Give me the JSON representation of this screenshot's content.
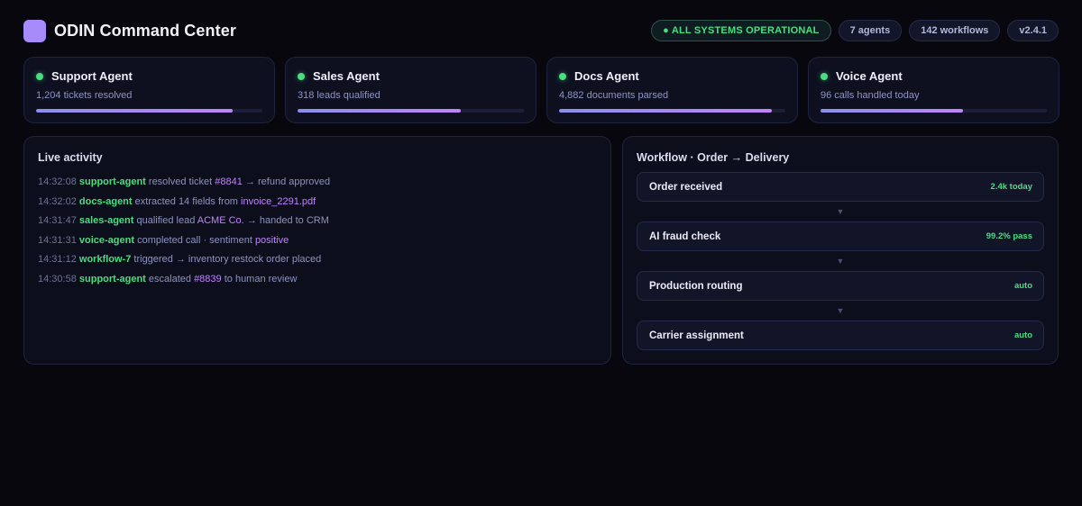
{
  "header": {
    "title": "ODIN Command Center",
    "status": "● ALL SYSTEMS OPERATIONAL",
    "agents_count": "7 agents",
    "workflows_count": "142 workflows",
    "version": "v2.4.1"
  },
  "agents": [
    {
      "name": "Support Agent",
      "stat": "1,204 tickets resolved",
      "progress": 0.87
    },
    {
      "name": "Sales Agent",
      "stat": "318 leads qualified",
      "progress": 0.72
    },
    {
      "name": "Docs Agent",
      "stat": "4,882 documents parsed",
      "progress": 0.94
    },
    {
      "name": "Voice Agent",
      "stat": "96 calls handled today",
      "progress": 0.63
    }
  ],
  "activity": {
    "title": "Live activity",
    "lines": [
      {
        "time": "14:32:08",
        "agent": "support-agent",
        "text1": "resolved ticket",
        "hl1": "#8841",
        "text2": "→ refund approved",
        "hl2": "",
        "text3": ""
      },
      {
        "time": "14:32:02",
        "agent": "docs-agent",
        "text1": "extracted 14 fields from",
        "hl1": "invoice_2291.pdf",
        "text2": "",
        "hl2": "",
        "text3": ""
      },
      {
        "time": "14:31:47",
        "agent": "sales-agent",
        "text1": "qualified lead",
        "hl1": "ACME Co.",
        "text2": "→ handed to CRM",
        "hl2": "",
        "text3": ""
      },
      {
        "time": "14:31:31",
        "agent": "voice-agent",
        "text1": "completed call · sentiment",
        "hl1": "positive",
        "text2": "",
        "hl2": "",
        "text3": ""
      },
      {
        "time": "14:31:12",
        "agent": "workflow-7",
        "text1": "triggered → inventory restock order placed",
        "hl1": "",
        "text2": "",
        "hl2": "",
        "text3": ""
      },
      {
        "time": "14:30:58",
        "agent": "support-agent",
        "text1": "escalated",
        "hl1": "#8839",
        "text2": "to human review",
        "hl2": "",
        "text3": ""
      }
    ]
  },
  "workflow": {
    "title": "Workflow · Order → Delivery",
    "arrow": "▼",
    "steps": [
      {
        "label": "Order received",
        "meta": "2.4k today"
      },
      {
        "label": "AI fraud check",
        "meta": "99.2% pass"
      },
      {
        "label": "Production routing",
        "meta": "auto"
      },
      {
        "label": "Carrier assignment",
        "meta": "auto"
      }
    ]
  },
  "colors": {
    "accent": "#a78bfa",
    "success": "#4ade80",
    "highlight": "#c084fc",
    "background": "#07070d"
  }
}
